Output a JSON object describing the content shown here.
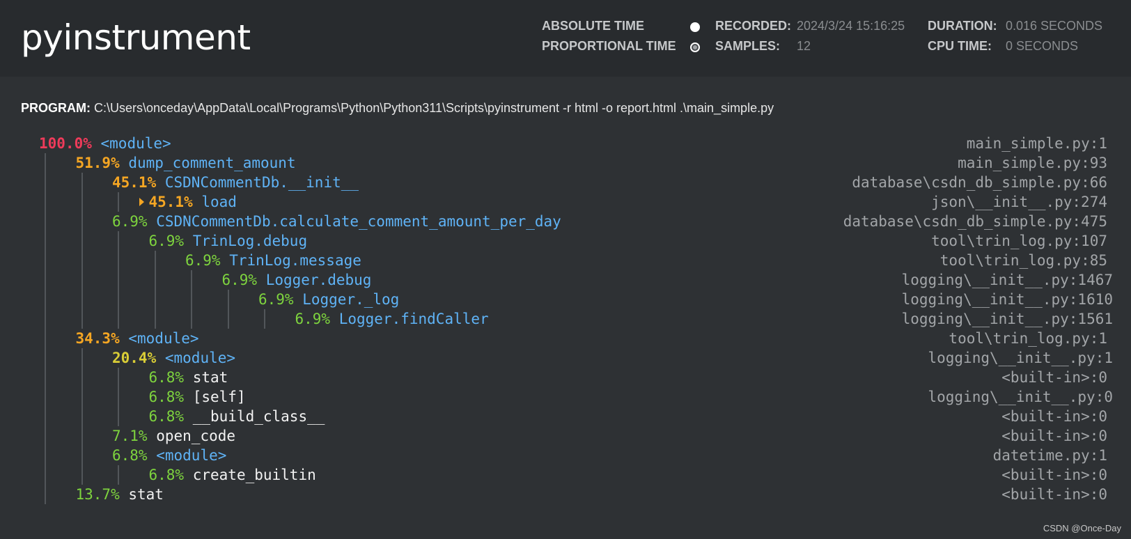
{
  "header": {
    "title": "pyinstrument",
    "modes": [
      {
        "label": "ABSOLUTE TIME",
        "selected": false
      },
      {
        "label": "PROPORTIONAL TIME",
        "selected": true
      }
    ],
    "recorded_label": "RECORDED:",
    "recorded_value": "2024/3/24 15:16:25",
    "samples_label": "SAMPLES:",
    "samples_value": "12",
    "duration_label": "DURATION:",
    "duration_value": "0.016 SECONDS",
    "cpu_label": "CPU TIME:",
    "cpu_value": "0 SECONDS"
  },
  "program": {
    "label": "PROGRAM:",
    "command": "C:\\Users\\onceday\\AppData\\Local\\Programs\\Python\\Python311\\Scripts\\pyinstrument -r html -o report.html .\\main_simple.py"
  },
  "frames": [
    {
      "pct": "100.0%",
      "color": "red",
      "fn": "<module>",
      "kind": "py",
      "loc": "main_simple.py:1",
      "depth": 0
    },
    {
      "pct": "51.9%",
      "color": "orange",
      "fn": "dump_comment_amount",
      "kind": "py",
      "loc": "main_simple.py:93",
      "depth": 1
    },
    {
      "pct": "45.1%",
      "color": "orange",
      "fn": "CSDNCommentDb.__init__",
      "kind": "py",
      "loc": "database\\csdn_db_simple.py:66",
      "depth": 2
    },
    {
      "pct": "45.1%",
      "color": "orange",
      "fn": "load",
      "kind": "py",
      "loc": "json\\__init__.py:274",
      "depth": 3,
      "collapsed": true
    },
    {
      "pct": "6.9%",
      "color": "green",
      "fn": "CSDNCommentDb.calculate_comment_amount_per_day",
      "kind": "py",
      "loc": "database\\csdn_db_simple.py:475",
      "depth": 2
    },
    {
      "pct": "6.9%",
      "color": "green",
      "fn": "TrinLog.debug",
      "kind": "py",
      "loc": "tool\\trin_log.py:107",
      "depth": 3
    },
    {
      "pct": "6.9%",
      "color": "green",
      "fn": "TrinLog.message",
      "kind": "py",
      "loc": "tool\\trin_log.py:85",
      "depth": 4
    },
    {
      "pct": "6.9%",
      "color": "green",
      "fn": "Logger.debug",
      "kind": "py",
      "loc": "logging\\__init__.py:1467",
      "depth": 5
    },
    {
      "pct": "6.9%",
      "color": "green",
      "fn": "Logger._log",
      "kind": "py",
      "loc": "logging\\__init__.py:1610",
      "depth": 6
    },
    {
      "pct": "6.9%",
      "color": "green",
      "fn": "Logger.findCaller",
      "kind": "py",
      "loc": "logging\\__init__.py:1561",
      "depth": 7
    },
    {
      "pct": "34.3%",
      "color": "orange",
      "fn": "<module>",
      "kind": "py",
      "loc": "tool\\trin_log.py:1",
      "depth": 1
    },
    {
      "pct": "20.4%",
      "color": "yellow",
      "fn": "<module>",
      "kind": "py",
      "loc": "logging\\__init__.py:1",
      "depth": 2
    },
    {
      "pct": "6.8%",
      "color": "green",
      "fn": "stat",
      "kind": "builtin",
      "loc": "<built-in>:0",
      "depth": 3
    },
    {
      "pct": "6.8%",
      "color": "green",
      "fn": "[self]",
      "kind": "builtin",
      "loc": "logging\\__init__.py:0",
      "depth": 3
    },
    {
      "pct": "6.8%",
      "color": "green",
      "fn": "__build_class__",
      "kind": "builtin",
      "loc": "<built-in>:0",
      "depth": 3
    },
    {
      "pct": "7.1%",
      "color": "green",
      "fn": "open_code",
      "kind": "builtin",
      "loc": "<built-in>:0",
      "depth": 2
    },
    {
      "pct": "6.8%",
      "color": "green",
      "fn": "<module>",
      "kind": "py",
      "loc": "datetime.py:1",
      "depth": 2
    },
    {
      "pct": "6.8%",
      "color": "green",
      "fn": "create_builtin",
      "kind": "builtin",
      "loc": "<built-in>:0",
      "depth": 3
    },
    {
      "pct": "13.7%",
      "color": "green",
      "fn": "stat",
      "kind": "builtin",
      "loc": "<built-in>:0",
      "depth": 1
    }
  ],
  "watermark": "CSDN @Once-Day"
}
